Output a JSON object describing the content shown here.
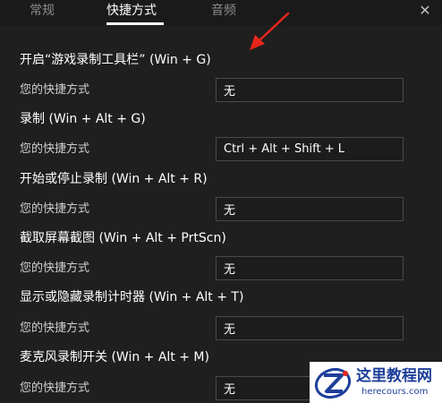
{
  "tabs": [
    {
      "label": "常规"
    },
    {
      "label": "快捷方式"
    },
    {
      "label": "音频"
    }
  ],
  "close_glyph": "✕",
  "sections": [
    {
      "title": "开启“游戏录制工具栏” (Win + G)",
      "field_label": "您的快捷方式",
      "value": "无"
    },
    {
      "title": "录制 (Win + Alt + G)",
      "field_label": "您的快捷方式",
      "value": "Ctrl + Alt + Shift + L"
    },
    {
      "title": "开始或停止录制 (Win + Alt + R)",
      "field_label": "您的快捷方式",
      "value": "无"
    },
    {
      "title": "截取屏幕截图 (Win + Alt + PrtScn)",
      "field_label": "您的快捷方式",
      "value": "无"
    },
    {
      "title": "显示或隐藏录制计时器 (Win + Alt + T)",
      "field_label": "您的快捷方式",
      "value": "无"
    },
    {
      "title": "麦克风录制开关 (Win + Alt + M)",
      "field_label": "您的快捷方式",
      "value": "无"
    }
  ],
  "watermark": {
    "name": "这里教程网",
    "url": "herecours.com"
  },
  "colors": {
    "background": "#1f1f1f",
    "arrow": "#e8261b",
    "watermark_text": "#1d3f9a"
  }
}
